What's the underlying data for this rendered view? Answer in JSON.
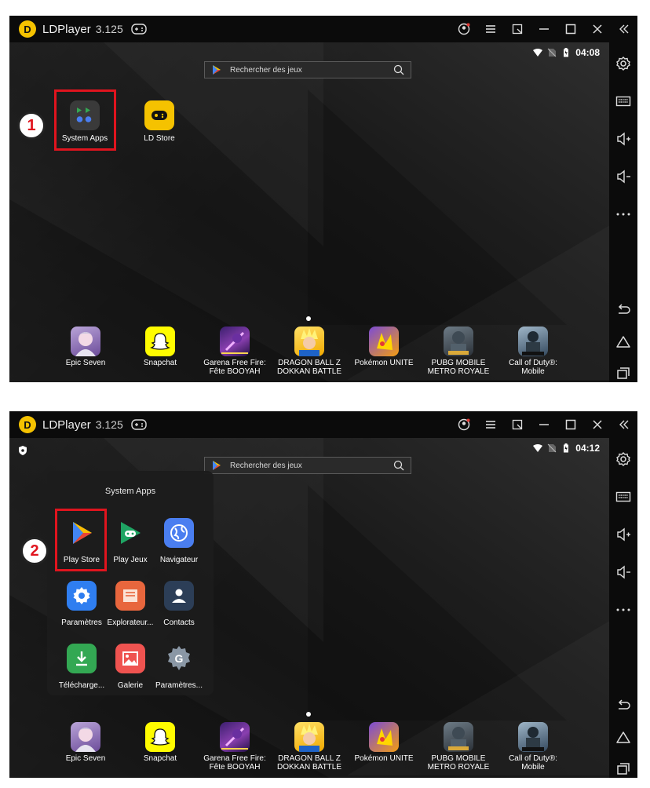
{
  "window": {
    "app_name": "LDPlayer",
    "version": "3.125"
  },
  "search": {
    "placeholder": "Rechercher des jeux"
  },
  "panels": [
    {
      "time": "04:08",
      "step_number": "1",
      "desktop_icons": [
        {
          "label": "System Apps"
        },
        {
          "label": "LD Store"
        }
      ]
    },
    {
      "time": "04:12",
      "step_number": "2",
      "folder": {
        "title": "System Apps",
        "apps": [
          {
            "label": "Play Store"
          },
          {
            "label": "Play Jeux"
          },
          {
            "label": "Navigateur"
          },
          {
            "label": "Paramètres"
          },
          {
            "label": "Explorateur..."
          },
          {
            "label": "Contacts"
          },
          {
            "label": "Télécharge..."
          },
          {
            "label": "Galerie"
          },
          {
            "label": "Paramètres..."
          }
        ]
      }
    }
  ],
  "dock": [
    {
      "line1": "Epic Seven",
      "line2": ""
    },
    {
      "line1": "Snapchat",
      "line2": ""
    },
    {
      "line1": "Garena Free Fire:",
      "line2": "Fête BOOYAH"
    },
    {
      "line1": "DRAGON BALL Z",
      "line2": "DOKKAN BATTLE"
    },
    {
      "line1": "Pokémon UNITE",
      "line2": ""
    },
    {
      "line1": "PUBG MOBILE",
      "line2": "METRO ROYALE"
    },
    {
      "line1": "Call of Duty®:",
      "line2": "Mobile"
    }
  ],
  "colors": {
    "highlight": "#e0141e",
    "logo": "#f5c200",
    "snapchat": "#fffc00"
  },
  "icons": [
    "ldplayer-logo-icon",
    "gamepad-icon",
    "account-icon",
    "menu-icon",
    "screenshot-icon",
    "minimize-icon",
    "maximize-icon",
    "close-icon",
    "collapse-icon",
    "settings-icon",
    "keyboard-icon",
    "volume-up-icon",
    "volume-down-icon",
    "more-icon",
    "back-icon",
    "home-icon",
    "recents-icon",
    "wifi-icon",
    "battery-icon",
    "search-icon"
  ]
}
